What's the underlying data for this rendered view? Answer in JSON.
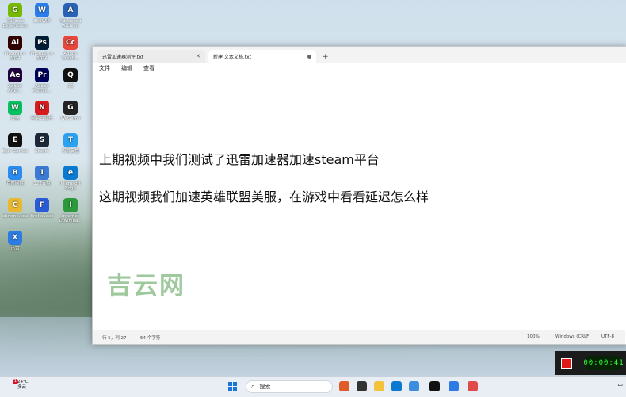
{
  "notepad": {
    "tabs": [
      {
        "label": "迅雷加速器测评.txt",
        "active": false
      },
      {
        "label": "新建 文本文档.txt",
        "active": true
      }
    ],
    "new_tab_label": "+",
    "menu": [
      "文件",
      "编辑",
      "查看"
    ],
    "content": {
      "line1": "上期视频中我们测试了迅雷加速器加速steam平台",
      "line2": "这期视频我们加速英雄联盟美服，在游戏中看看延迟怎么样"
    },
    "status": {
      "position": "行 5，列 27",
      "chars": "54 个字符",
      "zoom": "100%",
      "encoding": "Windows (CRLF)",
      "charset": "UTF-8"
    }
  },
  "watermark": "吉云网",
  "desktop_icons": [
    {
      "label": "GeForce Experience",
      "color": "#76b900",
      "glyph": "G"
    },
    {
      "label": "360WiFi",
      "color": "#2b7de9",
      "glyph": "W"
    },
    {
      "label": "Advanced Archive",
      "color": "#2a63b6",
      "glyph": "A"
    },
    {
      "label": "Illustrator 2024",
      "color": "#300",
      "glyph": "Ai"
    },
    {
      "label": "Photoshop 2024",
      "color": "#001e36",
      "glyph": "Ps"
    },
    {
      "label": "Adobe Creati...",
      "color": "#e8473b",
      "glyph": "Cc"
    },
    {
      "label": "Adobe After...",
      "color": "#1f0040",
      "glyph": "Ae"
    },
    {
      "label": "Adobe Premie...",
      "color": "#00005b",
      "glyph": "Pr"
    },
    {
      "label": "QQ",
      "color": "#111",
      "glyph": "Q"
    },
    {
      "label": "微信",
      "color": "#07c160",
      "glyph": "W"
    },
    {
      "label": "网易云音乐",
      "color": "#d61c1c",
      "glyph": "N"
    },
    {
      "label": "WeGame",
      "color": "#222",
      "glyph": "G"
    },
    {
      "label": "Epic Games",
      "color": "#111",
      "glyph": "E"
    },
    {
      "label": "Steam",
      "color": "#1b2838",
      "glyph": "S"
    },
    {
      "label": "天翼云盘",
      "color": "#2aa2f0",
      "glyph": "T"
    },
    {
      "label": "百度网盘",
      "color": "#2a8cf0",
      "glyph": "B"
    },
    {
      "label": "123云盘",
      "color": "#3a7bd5",
      "glyph": "1"
    },
    {
      "label": "Microsoft Edge",
      "color": "#0a7ad1",
      "glyph": "e"
    },
    {
      "label": "chrome.exe",
      "color": "#e8b830",
      "glyph": "C"
    },
    {
      "label": "firefox.exe",
      "color": "#2a5bd7",
      "glyph": "F"
    },
    {
      "label": "Internet Downloa...",
      "color": "#2c9a3c",
      "glyph": "I"
    },
    {
      "label": "迅雷",
      "color": "#2d7ce3",
      "glyph": "X"
    }
  ],
  "taskbar": {
    "weather_temp": "24°C",
    "weather_desc": "多云",
    "weather_badge": "1",
    "search_placeholder": "搜索",
    "ime": "中"
  },
  "recorder": {
    "time": "00:00:41"
  }
}
